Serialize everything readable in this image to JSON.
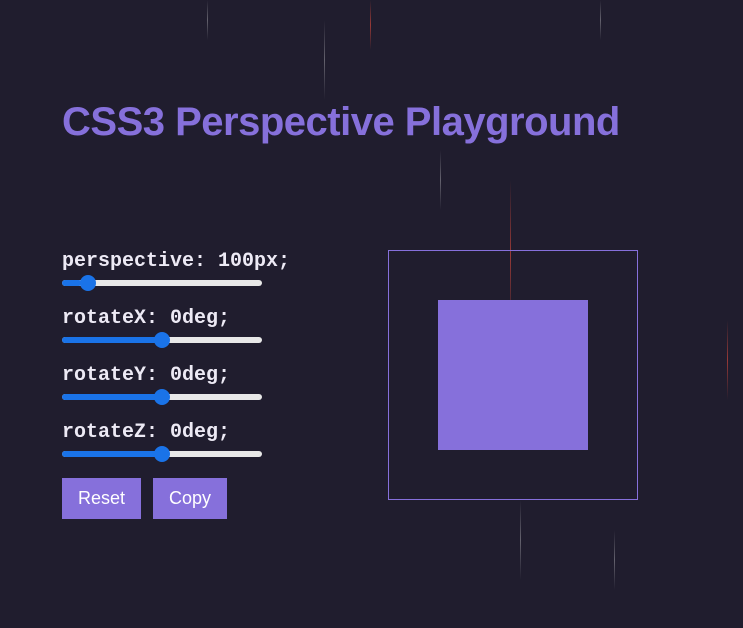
{
  "title": "CSS3 Perspective Playground",
  "sliders": {
    "perspective": {
      "label": "perspective: 100px;",
      "min": "0",
      "max": "999",
      "value": "100",
      "fillPercent": 10
    },
    "rotateX": {
      "label": "rotateX: 0deg;",
      "min": "-180",
      "max": "180",
      "value": "0",
      "fillPercent": 50
    },
    "rotateY": {
      "label": "rotateY: 0deg;",
      "min": "-180",
      "max": "180",
      "value": "0",
      "fillPercent": 50
    },
    "rotateZ": {
      "label": "rotateZ: 0deg;",
      "min": "-180",
      "max": "180",
      "value": "0",
      "fillPercent": 50
    }
  },
  "buttons": {
    "reset": "Reset",
    "copy": "Copy"
  },
  "colors": {
    "accent": "#8670db",
    "background": "#201d2e",
    "sliderActive": "#1a73e8",
    "text": "#edeaf5"
  }
}
